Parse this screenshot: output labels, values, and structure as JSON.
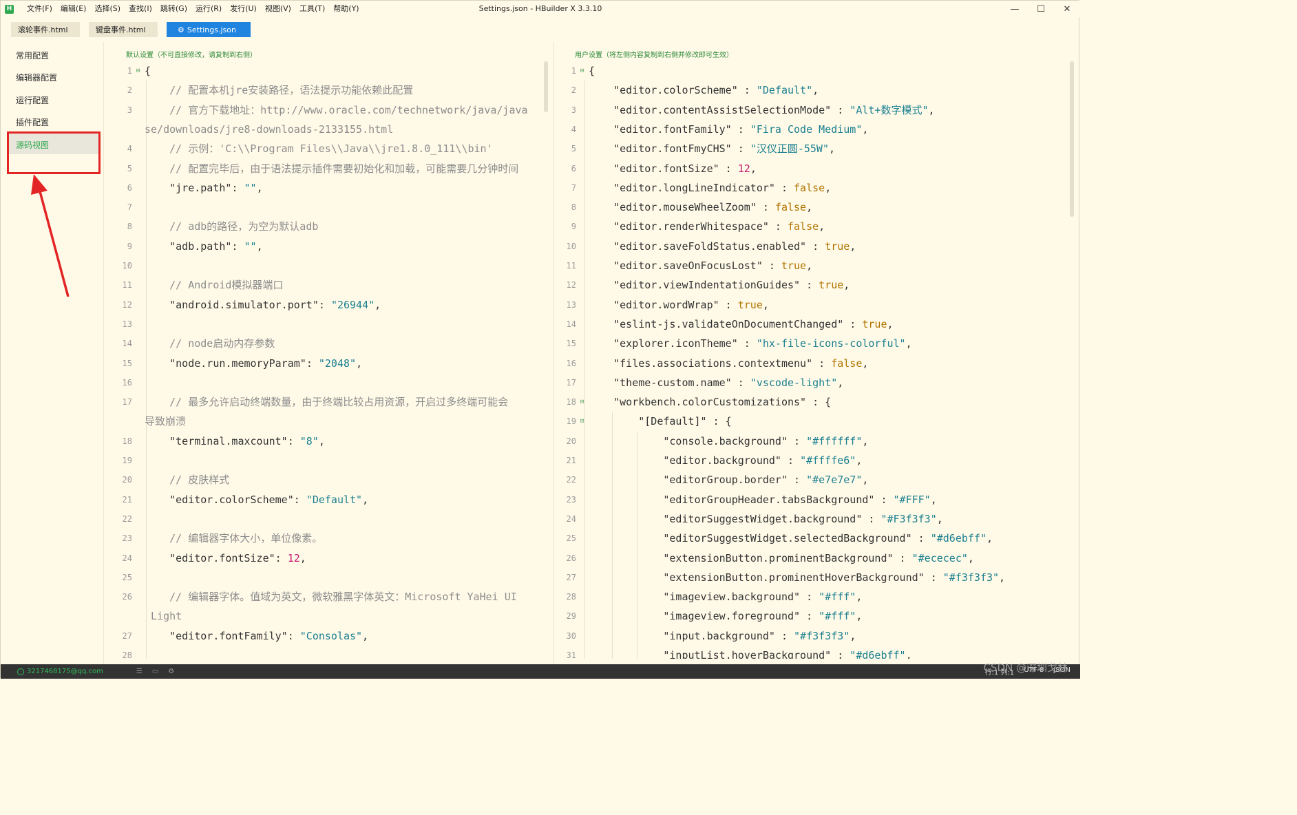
{
  "window": {
    "title": "Settings.json - HBuilder X 3.3.10",
    "logo": "H",
    "menus": [
      "文件(F)",
      "编辑(E)",
      "选择(S)",
      "查找(I)",
      "跳转(G)",
      "运行(R)",
      "发行(U)",
      "视图(V)",
      "工具(T)",
      "帮助(Y)"
    ],
    "controls": [
      "—",
      "☐",
      "✕"
    ]
  },
  "tabs": [
    {
      "label": "滚轮事件.html"
    },
    {
      "label": "键盘事件.html"
    },
    {
      "label": "Settings.json",
      "icon": "gear-icon"
    }
  ],
  "sidebar": {
    "items": [
      "常用配置",
      "编辑器配置",
      "运行配置",
      "插件配置",
      "源码视图"
    ],
    "active_index": 4
  },
  "left_pane": {
    "title": "默认设置（不可直接修改，请复制到右侧）",
    "lines": [
      {
        "n": "1",
        "t": [
          [
            "p",
            "{"
          ]
        ]
      },
      {
        "n": "2",
        "t": [
          [
            "c",
            "    // 配置本机jre安装路径，语法提示功能依赖此配置"
          ]
        ]
      },
      {
        "n": "3",
        "t": [
          [
            "c",
            "    // 官方下载地址：http://www.oracle.com/technetwork/java/java"
          ]
        ]
      },
      {
        "n": "",
        "t": [
          [
            "c",
            "se/downloads/jre8-downloads-2133155.html"
          ]
        ]
      },
      {
        "n": "4",
        "t": [
          [
            "c",
            "    // 示例：'C:\\\\Program Files\\\\Java\\\\jre1.8.0_111\\\\bin'"
          ]
        ]
      },
      {
        "n": "5",
        "t": [
          [
            "c",
            "    // 配置完毕后，由于语法提示插件需要初始化和加载，可能需要几分钟时间"
          ]
        ]
      },
      {
        "n": "6",
        "t": [
          [
            "k",
            "    \"jre.path\""
          ],
          [
            "p",
            ": "
          ],
          [
            "s",
            "\"\""
          ],
          [
            "p",
            ","
          ]
        ]
      },
      {
        "n": "7",
        "t": []
      },
      {
        "n": "8",
        "t": [
          [
            "c",
            "    // adb的路径，为空为默认adb"
          ]
        ]
      },
      {
        "n": "9",
        "t": [
          [
            "k",
            "    \"adb.path\""
          ],
          [
            "p",
            ": "
          ],
          [
            "s",
            "\"\""
          ],
          [
            "p",
            ","
          ]
        ]
      },
      {
        "n": "10",
        "t": []
      },
      {
        "n": "11",
        "t": [
          [
            "c",
            "    // Android模拟器端口"
          ]
        ]
      },
      {
        "n": "12",
        "t": [
          [
            "k",
            "    \"android.simulator.port\""
          ],
          [
            "p",
            ": "
          ],
          [
            "s",
            "\"26944\""
          ],
          [
            "p",
            ","
          ]
        ]
      },
      {
        "n": "13",
        "t": []
      },
      {
        "n": "14",
        "t": [
          [
            "c",
            "    // node启动内存参数"
          ]
        ]
      },
      {
        "n": "15",
        "t": [
          [
            "k",
            "    \"node.run.memoryParam\""
          ],
          [
            "p",
            ": "
          ],
          [
            "s",
            "\"2048\""
          ],
          [
            "p",
            ","
          ]
        ]
      },
      {
        "n": "16",
        "t": []
      },
      {
        "n": "17",
        "t": [
          [
            "c",
            "    // 最多允许启动终端数量，由于终端比较占用资源，开启过多终端可能会"
          ]
        ]
      },
      {
        "n": "",
        "t": [
          [
            "c",
            "导致崩溃"
          ]
        ]
      },
      {
        "n": "18",
        "t": [
          [
            "k",
            "    \"terminal.maxcount\""
          ],
          [
            "p",
            ": "
          ],
          [
            "s",
            "\"8\""
          ],
          [
            "p",
            ","
          ]
        ]
      },
      {
        "n": "19",
        "t": []
      },
      {
        "n": "20",
        "t": [
          [
            "c",
            "    // 皮肤样式"
          ]
        ]
      },
      {
        "n": "21",
        "t": [
          [
            "k",
            "    \"editor.colorScheme\""
          ],
          [
            "p",
            ": "
          ],
          [
            "s",
            "\"Default\""
          ],
          [
            "p",
            ","
          ]
        ]
      },
      {
        "n": "22",
        "t": []
      },
      {
        "n": "23",
        "t": [
          [
            "c",
            "    // 编辑器字体大小，单位像素。"
          ]
        ]
      },
      {
        "n": "24",
        "t": [
          [
            "k",
            "    \"editor.fontSize\""
          ],
          [
            "p",
            ": "
          ],
          [
            "num",
            "12"
          ],
          [
            "p",
            ","
          ]
        ]
      },
      {
        "n": "25",
        "t": []
      },
      {
        "n": "26",
        "t": [
          [
            "c",
            "    // 编辑器字体。值域为英文，微软雅黑字体英文：Microsoft YaHei UI"
          ]
        ]
      },
      {
        "n": "",
        "t": [
          [
            "c",
            " Light"
          ]
        ]
      },
      {
        "n": "27",
        "t": [
          [
            "k",
            "    \"editor.fontFamily\""
          ],
          [
            "p",
            ": "
          ],
          [
            "s",
            "\"Consolas\""
          ],
          [
            "p",
            ","
          ]
        ]
      },
      {
        "n": "28",
        "t": []
      }
    ]
  },
  "right_pane": {
    "title": "用户设置（将左侧内容复制到右侧并修改即可生效）",
    "lines": [
      {
        "n": "1",
        "t": [
          [
            "p",
            "{"
          ]
        ]
      },
      {
        "n": "2",
        "t": [
          [
            "k",
            "    \"editor.colorScheme\""
          ],
          [
            "p",
            " : "
          ],
          [
            "s",
            "\"Default\""
          ],
          [
            "p",
            ","
          ]
        ]
      },
      {
        "n": "3",
        "t": [
          [
            "k",
            "    \"editor.contentAssistSelectionMode\""
          ],
          [
            "p",
            " : "
          ],
          [
            "s",
            "\"Alt+数字模式\""
          ],
          [
            "p",
            ","
          ]
        ]
      },
      {
        "n": "4",
        "t": [
          [
            "k",
            "    \"editor.fontFamily\""
          ],
          [
            "p",
            " : "
          ],
          [
            "s",
            "\"Fira Code Medium\""
          ],
          [
            "p",
            ","
          ]
        ]
      },
      {
        "n": "5",
        "t": [
          [
            "k",
            "    \"editor.fontFmyCHS\""
          ],
          [
            "p",
            " : "
          ],
          [
            "s",
            "\"汉仪正圆-55W\""
          ],
          [
            "p",
            ","
          ]
        ]
      },
      {
        "n": "6",
        "t": [
          [
            "k",
            "    \"editor.fontSize\""
          ],
          [
            "p",
            " : "
          ],
          [
            "num",
            "12"
          ],
          [
            "p",
            ","
          ]
        ]
      },
      {
        "n": "7",
        "t": [
          [
            "k",
            "    \"editor.longLineIndicator\""
          ],
          [
            "p",
            " : "
          ],
          [
            "b",
            "false"
          ],
          [
            "p",
            ","
          ]
        ]
      },
      {
        "n": "8",
        "t": [
          [
            "k",
            "    \"editor.mouseWheelZoom\""
          ],
          [
            "p",
            " : "
          ],
          [
            "b",
            "false"
          ],
          [
            "p",
            ","
          ]
        ]
      },
      {
        "n": "9",
        "t": [
          [
            "k",
            "    \"editor.renderWhitespace\""
          ],
          [
            "p",
            " : "
          ],
          [
            "b",
            "false"
          ],
          [
            "p",
            ","
          ]
        ]
      },
      {
        "n": "10",
        "t": [
          [
            "k",
            "    \"editor.saveFoldStatus.enabled\""
          ],
          [
            "p",
            " : "
          ],
          [
            "b",
            "true"
          ],
          [
            "p",
            ","
          ]
        ]
      },
      {
        "n": "11",
        "t": [
          [
            "k",
            "    \"editor.saveOnFocusLost\""
          ],
          [
            "p",
            " : "
          ],
          [
            "b",
            "true"
          ],
          [
            "p",
            ","
          ]
        ]
      },
      {
        "n": "12",
        "t": [
          [
            "k",
            "    \"editor.viewIndentationGuides\""
          ],
          [
            "p",
            " : "
          ],
          [
            "b",
            "true"
          ],
          [
            "p",
            ","
          ]
        ]
      },
      {
        "n": "13",
        "t": [
          [
            "k",
            "    \"editor.wordWrap\""
          ],
          [
            "p",
            " : "
          ],
          [
            "b",
            "true"
          ],
          [
            "p",
            ","
          ]
        ]
      },
      {
        "n": "14",
        "t": [
          [
            "k",
            "    \"eslint-js.validateOnDocumentChanged\""
          ],
          [
            "p",
            " : "
          ],
          [
            "b",
            "true"
          ],
          [
            "p",
            ","
          ]
        ]
      },
      {
        "n": "15",
        "t": [
          [
            "k",
            "    \"explorer.iconTheme\""
          ],
          [
            "p",
            " : "
          ],
          [
            "s",
            "\"hx-file-icons-colorful\""
          ],
          [
            "p",
            ","
          ]
        ]
      },
      {
        "n": "16",
        "t": [
          [
            "k",
            "    \"files.associations.contextmenu\""
          ],
          [
            "p",
            " : "
          ],
          [
            "b",
            "false"
          ],
          [
            "p",
            ","
          ]
        ]
      },
      {
        "n": "17",
        "t": [
          [
            "k",
            "    \"theme-custom.name\""
          ],
          [
            "p",
            " : "
          ],
          [
            "s",
            "\"vscode-light\""
          ],
          [
            "p",
            ","
          ]
        ]
      },
      {
        "n": "18",
        "t": [
          [
            "k",
            "    \"workbench.colorCustomizations\""
          ],
          [
            "p",
            " : {"
          ]
        ]
      },
      {
        "n": "19",
        "t": [
          [
            "k",
            "        \"[Default]\""
          ],
          [
            "p",
            " : {"
          ]
        ]
      },
      {
        "n": "20",
        "t": [
          [
            "k",
            "            \"console.background\""
          ],
          [
            "p",
            " : "
          ],
          [
            "s",
            "\"#ffffff\""
          ],
          [
            "p",
            ","
          ]
        ]
      },
      {
        "n": "21",
        "t": [
          [
            "k",
            "            \"editor.background\""
          ],
          [
            "p",
            " : "
          ],
          [
            "s",
            "\"#ffffe6\""
          ],
          [
            "p",
            ","
          ]
        ]
      },
      {
        "n": "22",
        "t": [
          [
            "k",
            "            \"editorGroup.border\""
          ],
          [
            "p",
            " : "
          ],
          [
            "s",
            "\"#e7e7e7\""
          ],
          [
            "p",
            ","
          ]
        ]
      },
      {
        "n": "23",
        "t": [
          [
            "k",
            "            \"editorGroupHeader.tabsBackground\""
          ],
          [
            "p",
            " : "
          ],
          [
            "s",
            "\"#FFF\""
          ],
          [
            "p",
            ","
          ]
        ]
      },
      {
        "n": "24",
        "t": [
          [
            "k",
            "            \"editorSuggestWidget.background\""
          ],
          [
            "p",
            " : "
          ],
          [
            "s",
            "\"#F3f3f3\""
          ],
          [
            "p",
            ","
          ]
        ]
      },
      {
        "n": "25",
        "t": [
          [
            "k",
            "            \"editorSuggestWidget.selectedBackground\""
          ],
          [
            "p",
            " : "
          ],
          [
            "s",
            "\"#d6ebff\""
          ],
          [
            "p",
            ","
          ]
        ]
      },
      {
        "n": "26",
        "t": [
          [
            "k",
            "            \"extensionButton.prominentBackground\""
          ],
          [
            "p",
            " : "
          ],
          [
            "s",
            "\"#ececec\""
          ],
          [
            "p",
            ","
          ]
        ]
      },
      {
        "n": "27",
        "t": [
          [
            "k",
            "            \"extensionButton.prominentHoverBackground\""
          ],
          [
            "p",
            " : "
          ],
          [
            "s",
            "\"#f3f3f3\""
          ],
          [
            "p",
            ","
          ]
        ]
      },
      {
        "n": "28",
        "t": [
          [
            "k",
            "            \"imageview.background\""
          ],
          [
            "p",
            " : "
          ],
          [
            "s",
            "\"#fff\""
          ],
          [
            "p",
            ","
          ]
        ]
      },
      {
        "n": "29",
        "t": [
          [
            "k",
            "            \"imageview.foreground\""
          ],
          [
            "p",
            " : "
          ],
          [
            "s",
            "\"#fff\""
          ],
          [
            "p",
            ","
          ]
        ]
      },
      {
        "n": "30",
        "t": [
          [
            "k",
            "            \"input.background\""
          ],
          [
            "p",
            " : "
          ],
          [
            "s",
            "\"#f3f3f3\""
          ],
          [
            "p",
            ","
          ]
        ]
      },
      {
        "n": "31",
        "t": [
          [
            "k",
            "            \"inputList.hoverBackground\""
          ],
          [
            "p",
            " : "
          ],
          [
            "s",
            "\"#d6ebff\""
          ],
          [
            "p",
            ","
          ]
        ]
      }
    ]
  },
  "statusbar": {
    "user": "3217468175@qq.com",
    "icons": [
      "list-icon",
      "terminal-icon",
      "plugin-icon"
    ],
    "position": "行:1  列:1",
    "encoding": "UTF-8",
    "language": "JSON"
  },
  "watermark": "CSDN @深圳戈林",
  "colors": {
    "accent": "#1e84e0",
    "green": "#2fa84f",
    "annotation_red": "#e32424",
    "background": "#fffae8"
  }
}
